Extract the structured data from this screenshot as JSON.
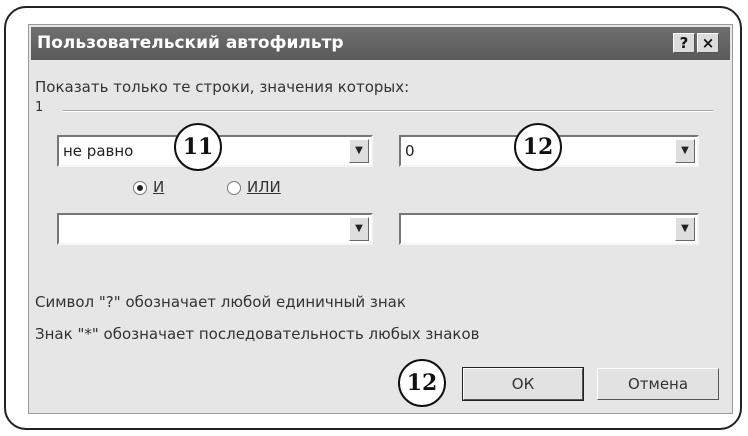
{
  "dialog": {
    "title": "Пользовательский автофильтр",
    "help_button": "?",
    "close_button": "×",
    "instruction": "Показать только те строки, значения которых:",
    "group_label": "1",
    "condition1": {
      "operator": "не равно",
      "value": "0"
    },
    "logic": {
      "and_label": "И",
      "or_label": "ИЛИ",
      "selected": "И"
    },
    "condition2": {
      "operator": "",
      "value": ""
    },
    "hint1": "Символ \"?\" обозначает любой единичный знак",
    "hint2": "Знак \"*\" обозначает последовательность любых знаков",
    "ok_label": "ОК",
    "cancel_label": "Отмена"
  },
  "callouts": {
    "operator_callout": "11",
    "value_callout": "12",
    "ok_callout": "12"
  },
  "colors": {
    "titlebar": "#5a5a5a",
    "dialog_bg": "#e6e6e6"
  }
}
